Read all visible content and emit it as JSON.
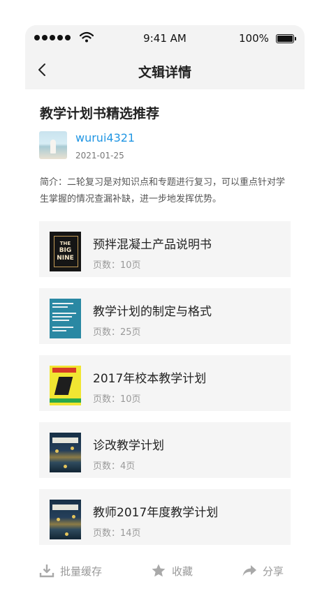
{
  "status_bar": {
    "time": "9:41 AM",
    "battery_text": "100%"
  },
  "nav": {
    "title": "文辑详情"
  },
  "album": {
    "title": "教学计划书精选推荐",
    "author": "wurui4321",
    "date": "2021-01-25",
    "intro": "简介：二轮复习是对知识点和专题进行复习，可以重点针对学生掌握的情况查漏补缺，进一步地发挥优势。"
  },
  "books": [
    {
      "title": "预拌混凝土产品说明书",
      "pages": "页数：10页",
      "cover_text": [
        "THE",
        "BIG",
        "NINE"
      ]
    },
    {
      "title": "教学计划的制定与格式",
      "pages": "页数：25页"
    },
    {
      "title": "2017年校本教学计划",
      "pages": "页数：10页"
    },
    {
      "title": "诊改教学计划",
      "pages": "页数：4页"
    },
    {
      "title": "教师2017年度教学计划",
      "pages": "页数：14页"
    }
  ],
  "toolbar": {
    "batch_cache": "批量缓存",
    "favorite": "收藏",
    "share": "分享"
  },
  "colors": {
    "link": "#2196e3",
    "nav_bg": "#f3f3f3",
    "card_bg": "#f5f5f5"
  },
  "icons": [
    "wifi-icon",
    "battery-icon",
    "back-icon",
    "download-icon",
    "star-icon",
    "share-icon"
  ]
}
